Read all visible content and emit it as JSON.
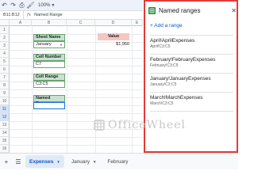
{
  "toolbar": {
    "icons": [
      "undo-icon",
      "redo-icon",
      "print-icon",
      "paint-format-icon"
    ],
    "zoom": "100%"
  },
  "formula_bar": {
    "name_box": "B11:B12",
    "fx": "fx",
    "value": "Named Range"
  },
  "grid": {
    "columns": [
      "A",
      "B",
      "C",
      "D",
      "E"
    ],
    "rows": [
      "1",
      "2",
      "3",
      "4",
      "5",
      "6",
      "7",
      "8",
      "9",
      "10",
      "11",
      "12",
      "13",
      "14",
      "15",
      "16"
    ],
    "selected_rows": [
      "11",
      "12"
    ],
    "cells": {
      "sheet_name_label": "Sheet Name",
      "sheet_name_value": "January",
      "cell_number_label": "Cell Number",
      "cell_number_value": "C7",
      "cell_range_label": "Cell Range",
      "cell_range_value": "C3:C5",
      "named_range_label": "Named Range",
      "value_label": "Value",
      "value_amount": "$1,950"
    }
  },
  "panel": {
    "title": "Named ranges",
    "add_label": "+ Add a range",
    "ranges": [
      {
        "name": "April!AprilExpenses",
        "ref": "April!C3:C5"
      },
      {
        "name": "February!FebruaryExpenses",
        "ref": "February!C3:C5"
      },
      {
        "name": "January!JanuaryExpenses",
        "ref": "January!C3:C5"
      },
      {
        "name": "March!MarchExpenses",
        "ref": "March!C3:C5"
      }
    ]
  },
  "bottom_bar": {
    "tabs": [
      {
        "label": "Expenses",
        "active": true
      },
      {
        "label": "January",
        "active": false
      },
      {
        "label": "February",
        "active": false
      }
    ]
  },
  "watermark": "OfficeWheel",
  "colors": {
    "accent": "#0b57d0",
    "panel_border": "#e53935",
    "label_green": "#c9e2cf",
    "label_pink": "#f4c7c3",
    "sheets_green": "#1e8e3e"
  }
}
